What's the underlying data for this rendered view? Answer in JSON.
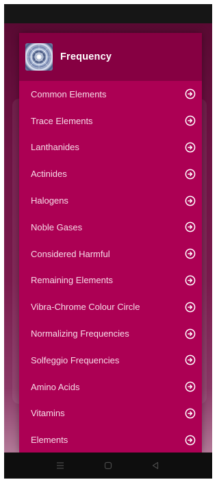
{
  "app": {
    "title": "Frequency"
  },
  "menu": {
    "items": [
      {
        "label": "Common Elements"
      },
      {
        "label": "Trace Elements"
      },
      {
        "label": "Lanthanides"
      },
      {
        "label": "Actinides"
      },
      {
        "label": "Halogens"
      },
      {
        "label": "Noble Gases"
      },
      {
        "label": "Considered Harmful"
      },
      {
        "label": "Remaining Elements"
      },
      {
        "label": "Vibra-Chrome Colour Circle"
      },
      {
        "label": "Normalizing Frequencies"
      },
      {
        "label": "Solfeggio Frequencies"
      },
      {
        "label": "Amino Acids"
      },
      {
        "label": "Vitamins"
      },
      {
        "label": "Elements"
      }
    ],
    "item_icon": "arrow-right-circle-icon"
  },
  "colors": {
    "drawer": "#ac0054",
    "header": "#860042",
    "text": "#f6dce8"
  },
  "navigation": {
    "buttons": [
      "menu-icon",
      "home-icon",
      "back-icon"
    ]
  }
}
